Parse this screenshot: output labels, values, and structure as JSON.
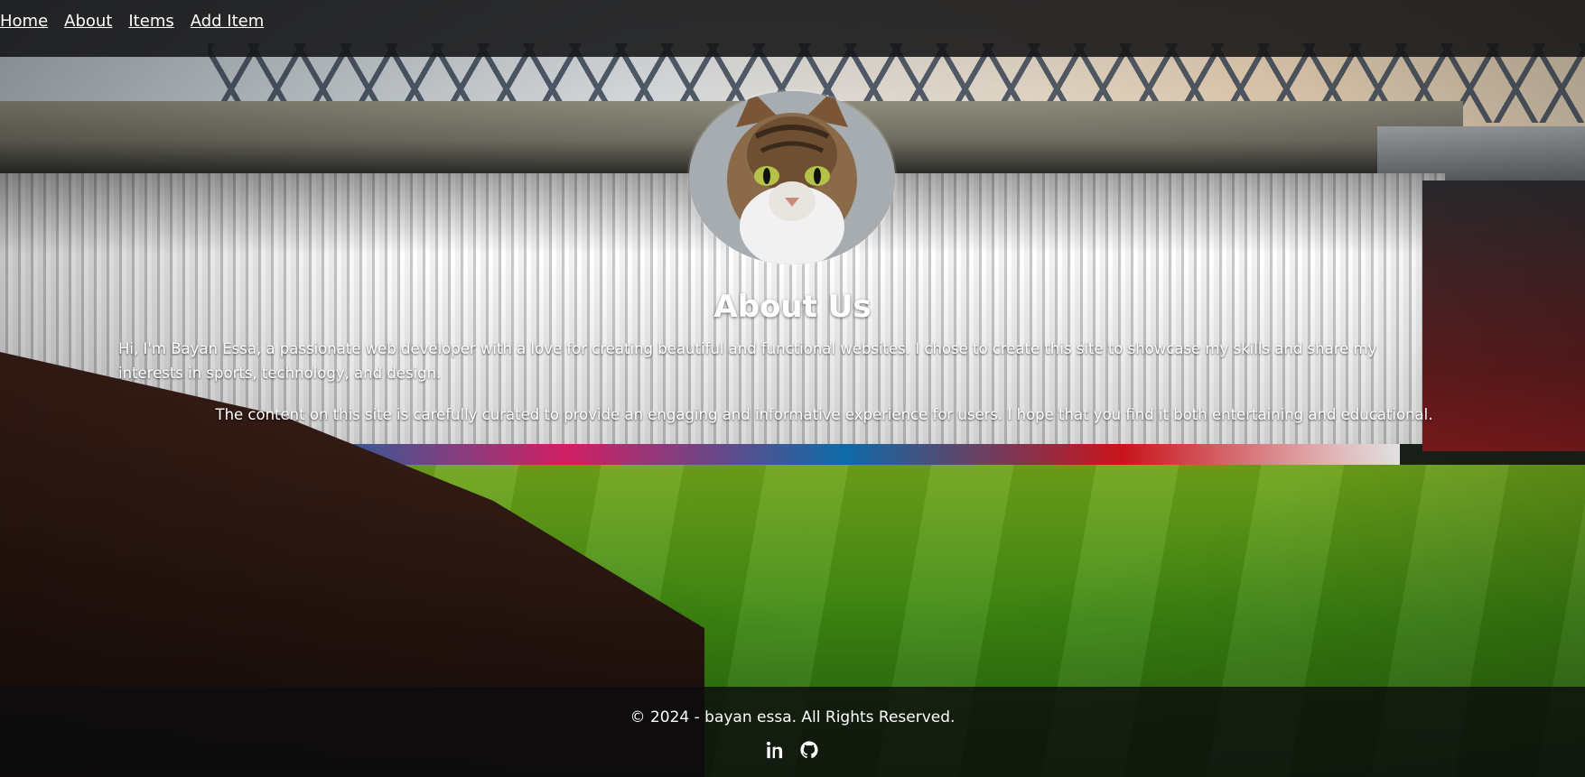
{
  "nav": {
    "links": [
      "Home",
      "About",
      "Items",
      "Add Item"
    ]
  },
  "about": {
    "title": "About Us",
    "paragraph_1": "Hi, I'm Bayan Essa, a passionate web developer with a love for creating beautiful and functional websites. I chose to create this site to showcase my skills and share my interests in sports, technology, and design.",
    "paragraph_2": "The content on this site is carefully curated to provide an engaging and informative experience for users. I hope that you find it both entertaining and educational."
  },
  "footer": {
    "copyright": "© 2024 - bayan essa. All Rights Reserved.",
    "social_icons": [
      "linkedin-icon",
      "github-icon"
    ]
  },
  "colors": {
    "navbar": "#141416",
    "text": "#ffffff"
  }
}
